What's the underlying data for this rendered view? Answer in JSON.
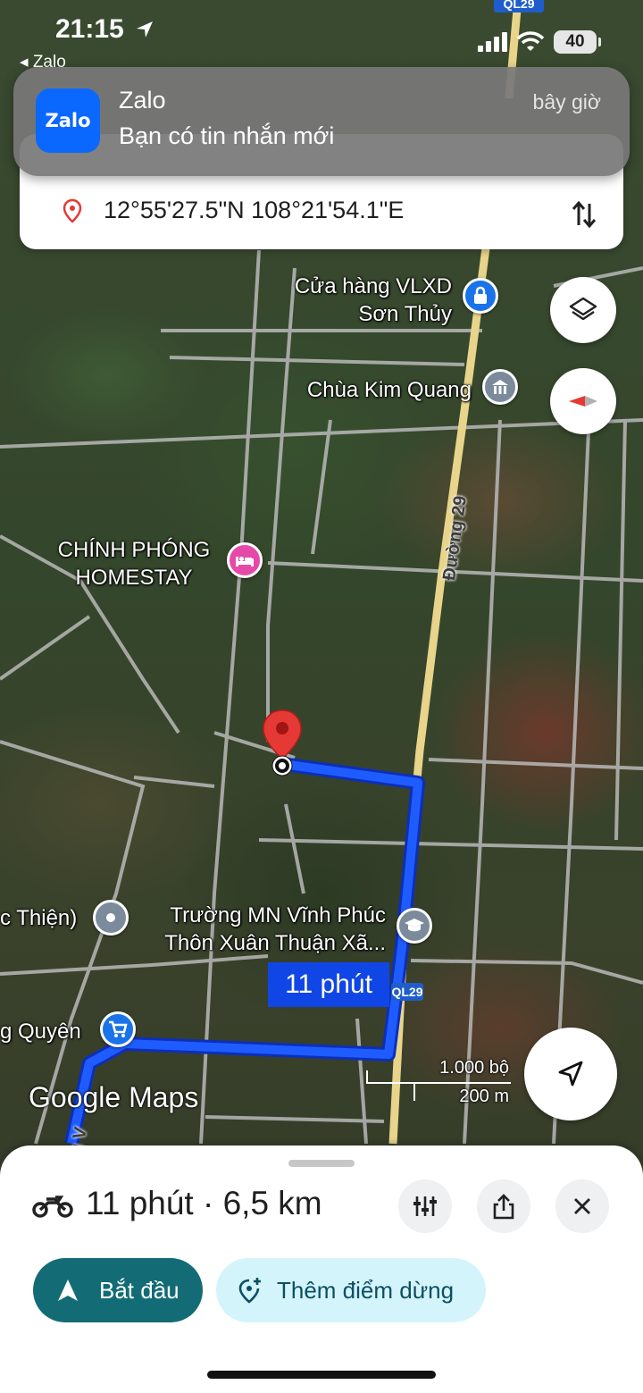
{
  "status_bar": {
    "time": "21:15",
    "back_label": "◂ Zalo",
    "battery": "40",
    "icons": [
      "location-arrow-icon",
      "cellular-signal-icon",
      "wifi-icon",
      "battery-icon"
    ]
  },
  "notification": {
    "app_name": "Zalo",
    "app_icon_text": "Zalo",
    "message": "Bạn có tin nhắn mới",
    "time": "bây giờ"
  },
  "destination": {
    "text": "12°55'27.5\"N 108°21'54.1\"E",
    "icons": [
      "map-pin-icon",
      "swap-icon"
    ]
  },
  "map": {
    "top_shield": "QL29",
    "route_shield": "QL29",
    "pois": [
      {
        "line1": "Cửa hàng VLXD",
        "line2": "Sơn Thủy",
        "type": "store-lock-icon"
      },
      {
        "line1": "Chùa Kim Quang",
        "type": "temple-icon"
      },
      {
        "line1": "CHÍNH PHÓNG",
        "line2": "HOMESTAY",
        "type": "hotel-bed-icon"
      },
      {
        "line1": "Trường MN Vĩnh Phúc",
        "line2": "Thôn Xuân Thuận Xã...",
        "type": "school-icon"
      },
      {
        "line1": "c Thiện)",
        "type": "place-icon"
      },
      {
        "line1": "g Quyên",
        "type": "shopping-cart-icon"
      }
    ],
    "road_label": "Đường 29",
    "road_label_bottom": "g V",
    "route_duration": "11 phút",
    "scale_top": "1.000 bộ",
    "scale_bottom": "200 m",
    "watermark": "Google Maps",
    "colors": {
      "route": "#1146e6",
      "highway": "#e8d48a",
      "pin": "#e53935"
    }
  },
  "bottom_sheet": {
    "summary": "11 phút · 6,5 km",
    "mode_icon": "motorcycle-icon",
    "start_label": "Bắt đầu",
    "add_stop_label": "Thêm điểm dừng",
    "colors": {
      "start": "#136c75",
      "add_stop_bg": "#d4f4fb"
    }
  }
}
